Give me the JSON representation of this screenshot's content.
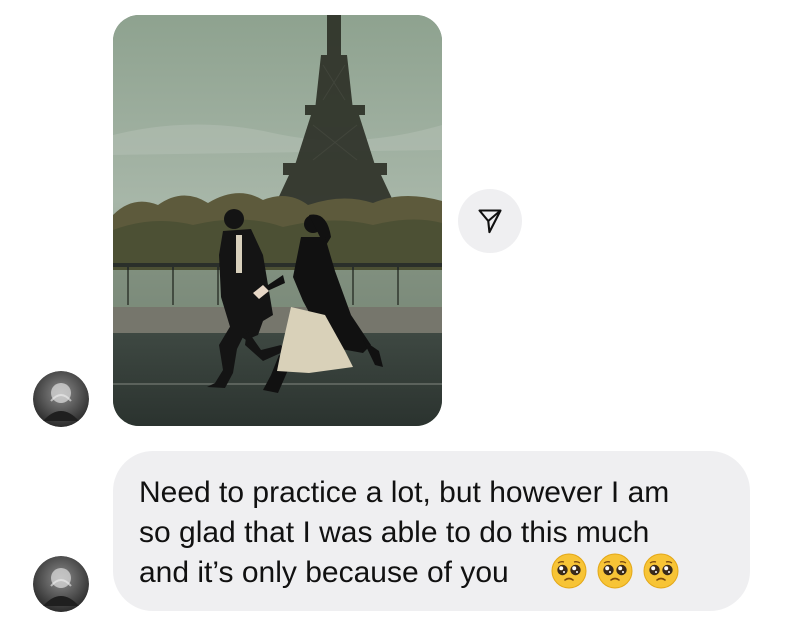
{
  "messages": [
    {
      "type": "photo",
      "image_subject": "couple-running-near-eiffel-tower",
      "share_icon": "paper-plane-icon",
      "avatar_icon": "contact-avatar-icon"
    },
    {
      "type": "text",
      "text": "Need to practice a lot, but however I am\nso glad that I was able to do this much\nand it’s only because of you",
      "emojis": [
        "pleading-face-emoji",
        "pleading-face-emoji",
        "pleading-face-emoji"
      ],
      "avatar_icon": "contact-avatar-icon"
    }
  ],
  "colors": {
    "bubble_background": "#efeff1",
    "text": "#111111",
    "share_button_background": "#efeff1"
  }
}
